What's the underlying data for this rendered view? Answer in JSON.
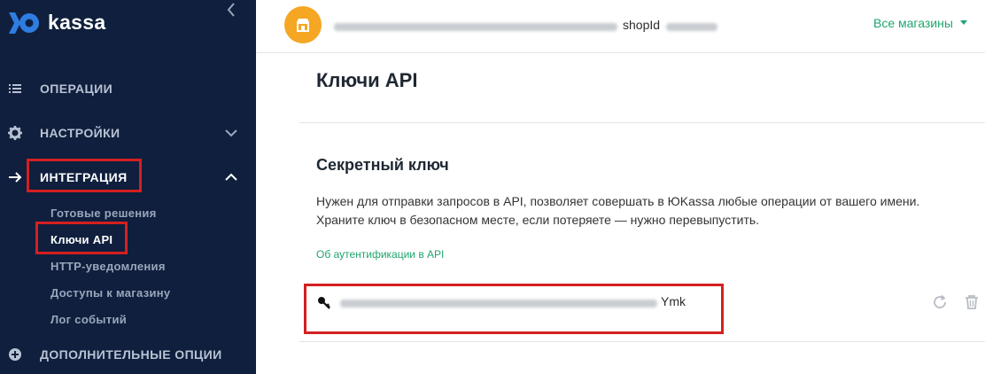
{
  "logo": {
    "text": "kassa"
  },
  "sidebar": {
    "items": [
      {
        "label": "ОПЕРАЦИИ",
        "icon": "list-icon"
      },
      {
        "label": "НАСТРОЙКИ",
        "icon": "gear-icon"
      },
      {
        "label": "ИНТЕГРАЦИЯ",
        "icon": "arrow-right-icon"
      },
      {
        "label": "ДОПОЛНИТЕЛЬНЫЕ ОПЦИИ",
        "icon": "plus-circle-icon"
      }
    ],
    "subitems": [
      {
        "label": "Готовые решения"
      },
      {
        "label": "Ключи API"
      },
      {
        "label": "HTTP-уведомления"
      },
      {
        "label": "Доступы к магазину"
      },
      {
        "label": "Лог событий"
      }
    ]
  },
  "topbar": {
    "shop_id_label": "shopId",
    "all_shops": "Все магазины"
  },
  "main": {
    "page_title": "Ключи API",
    "section_title": "Секретный ключ",
    "description_line1": "Нужен для отправки запросов в API, позволяет совершать в ЮKassa любые операции от вашего имени.",
    "description_line2": "Храните ключ в безопасном месте, если потеряете — нужно перевыпустить.",
    "auth_link": "Об аутентификации в API",
    "key_tail": "Ymk"
  },
  "colors": {
    "sidebar_bg": "#0f1f3d",
    "accent_green": "#20a46f",
    "highlight_red": "#d42020",
    "shop_avatar": "#f5a623"
  }
}
